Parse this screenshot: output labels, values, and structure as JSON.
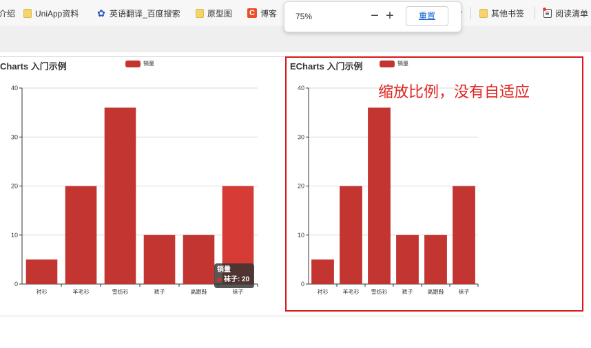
{
  "bookmarks": {
    "items": [
      {
        "label": "介绍",
        "icon": "folder-icon"
      },
      {
        "label": "UniApp资料",
        "icon": "folder-icon"
      },
      {
        "label": "英语翻译_百度搜索",
        "icon": "baidu-paw-icon"
      },
      {
        "label": "原型图",
        "icon": "folder-icon"
      },
      {
        "label": "博客",
        "icon": "c-logo-icon"
      }
    ],
    "right_items": [
      {
        "label": "其他书签",
        "icon": "folder-icon"
      },
      {
        "label": "阅读清单",
        "icon": "reading-list-icon"
      }
    ],
    "c_glyph": "C"
  },
  "zoom": {
    "value": "75%",
    "minus": "−",
    "plus": "+",
    "reset_label": "重置"
  },
  "colors": {
    "bar": "#c23531",
    "bar_highlight": "#d63c35",
    "annotation": "#e0241f",
    "frame": "#d9141b"
  },
  "charts": [
    {
      "title": "Charts 入门示例",
      "legend": "销量",
      "chart_data": {
        "type": "bar",
        "title": "ECharts 入门示例",
        "categories": [
          "衬衫",
          "羊毛衫",
          "雪纺衫",
          "裤子",
          "高跟鞋",
          "袜子"
        ],
        "series": [
          {
            "name": "销量",
            "values": [
              5,
              20,
              36,
              10,
              10,
              20
            ]
          }
        ],
        "ylim": [
          0,
          40
        ],
        "yticks": [
          0,
          10,
          20,
          30,
          40
        ],
        "grid": true,
        "legend_position": "top"
      }
    },
    {
      "title": "ECharts 入门示例",
      "legend": "销量",
      "chart_data": {
        "type": "bar",
        "title": "ECharts 入门示例",
        "categories": [
          "衬衫",
          "羊毛衫",
          "雪纺衫",
          "裤子",
          "高跟鞋",
          "袜子"
        ],
        "series": [
          {
            "name": "销量",
            "values": [
              5,
              20,
              36,
              10,
              10,
              20
            ]
          }
        ],
        "ylim": [
          0,
          40
        ],
        "yticks": [
          0,
          10,
          20,
          30,
          40
        ],
        "grid": true,
        "legend_position": "top"
      }
    }
  ],
  "annotation": "缩放比例，没有自适应",
  "tooltip": {
    "series": "销量",
    "item": "袜子: 20"
  }
}
